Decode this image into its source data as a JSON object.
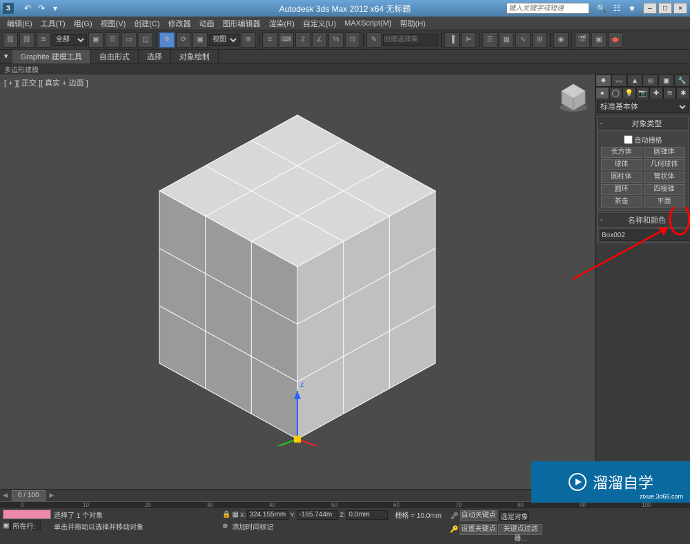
{
  "titlebar": {
    "app_title": "Autodesk 3ds Max 2012 x64   无标题",
    "logo": "3",
    "search_placeholder": "键入关键字或短语"
  },
  "window_controls": {
    "minimize": "–",
    "maximize": "□",
    "close": "×"
  },
  "menubar": [
    "编辑(E)",
    "工具(T)",
    "组(G)",
    "视图(V)",
    "创建(C)",
    "修改器",
    "动画",
    "图形编辑器",
    "渲染(R)",
    "自定义(U)",
    "MAXScript(M)",
    "帮助(H)"
  ],
  "toolbar": {
    "all_dropdown": "全部",
    "view_btn": "视图",
    "selset_placeholder": "创建选择集"
  },
  "ribbon": {
    "tabs": [
      "Graphite 建模工具",
      "自由形式",
      "选择",
      "对象绘制"
    ],
    "subribbon": "多边形建模"
  },
  "viewport": {
    "label": "[ + ][ 正交 ][ 真实 + 边面 ]"
  },
  "rightpanel": {
    "dropdown": "标准基本体",
    "rollout1": {
      "title": "对象类型",
      "autogrid": "自动栅格",
      "primitives": [
        [
          "长方体",
          "圆锥体"
        ],
        [
          "球体",
          "几何球体"
        ],
        [
          "圆柱体",
          "管状体"
        ],
        [
          "圆环",
          "四棱锥"
        ],
        [
          "茶壶",
          "平面"
        ]
      ]
    },
    "rollout2": {
      "title": "名称和颜色",
      "name_value": "Box002"
    }
  },
  "timeslider": {
    "display": "0 / 100"
  },
  "statusbar": {
    "selection_info": "选择了 1 个对象",
    "prompt": "单击并拖动以选择并移动对象",
    "x_value": "324.155mm",
    "y_value": "-165.744m",
    "z_value": "0.0mm",
    "grid_label": "栅格 = 10.0mm",
    "autokey_label": "自动关键点",
    "setkey_label": "设置关键点",
    "selected_label": "选定对象",
    "keyfilter_label": "关键点过滤器...",
    "addtime_label": "添加时间标记",
    "current_row": "所在行:"
  },
  "watermark": {
    "text": "溜溜自学",
    "url": "zixue.3d66.com"
  }
}
